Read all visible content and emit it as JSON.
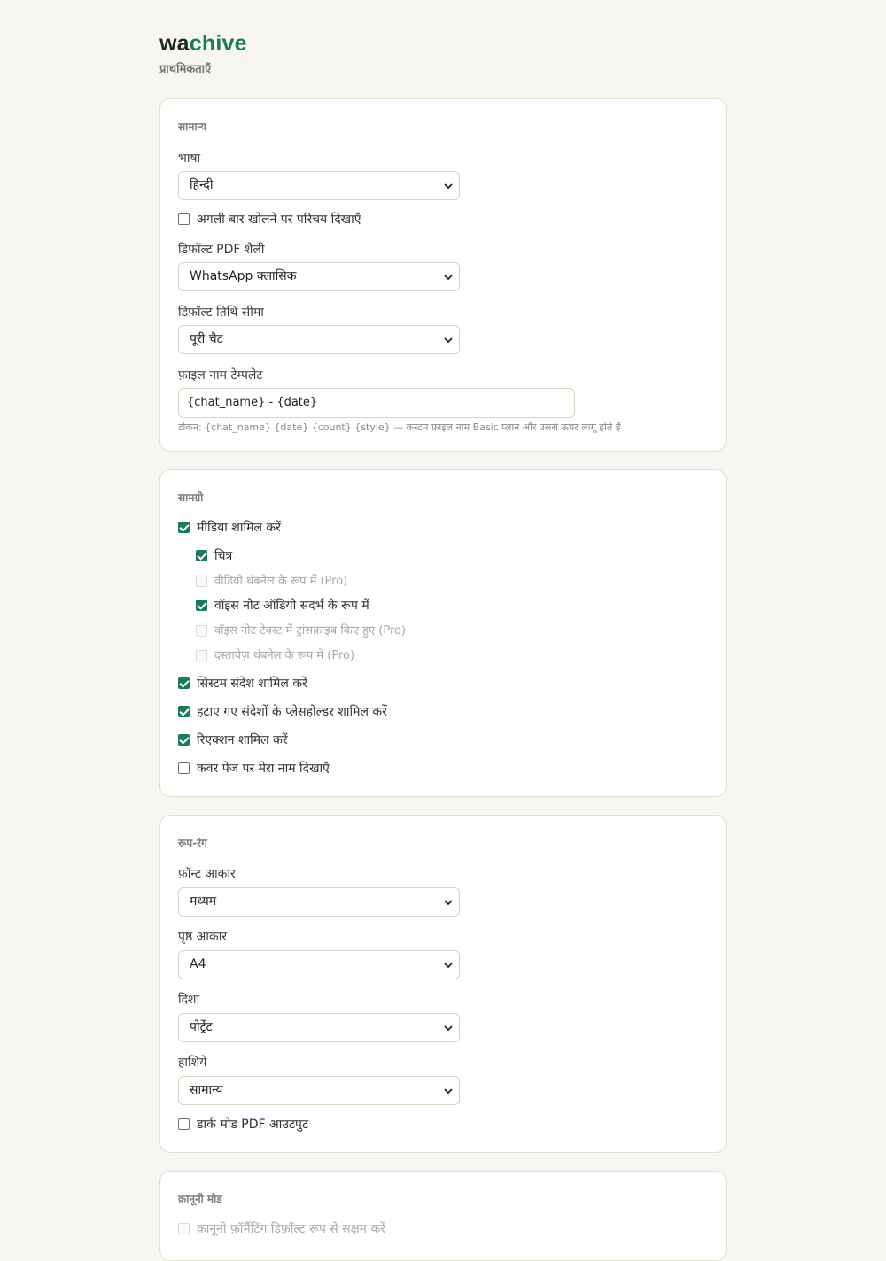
{
  "brand": {
    "prefix": "wa",
    "suffix": "chive",
    "accent": "#1a7a5e"
  },
  "page_title": "प्राथमिकताएँ",
  "general": {
    "title": "सामान्य",
    "language": {
      "label": "भाषा",
      "value": "हिन्दी"
    },
    "show_intro": {
      "label": "अगली बार खोलने पर परिचय दिखाएँ",
      "checked": false
    },
    "pdf_style": {
      "label": "डिफ़ॉल्ट PDF शैली",
      "value": "WhatsApp क्लासिक"
    },
    "date_range": {
      "label": "डिफ़ॉल्ट तिथि सीमा",
      "value": "पूरी चैट"
    },
    "filename": {
      "label": "फ़ाइल नाम टेम्पलेट",
      "value": "{chat_name} - {date}",
      "hint": "टोकन: {chat_name} {date} {count} {style} — कस्टम फ़ाइल नाम Basic प्लान और उससे ऊपर लागू होते हैं"
    }
  },
  "content": {
    "title": "सामग्री",
    "items": [
      {
        "label": "मीडिया शामिल करें",
        "checked": true,
        "disabled": false
      },
      {
        "label": "चित्र",
        "checked": true,
        "disabled": false
      },
      {
        "label": "वीडियो थंबनेल के रूप में (Pro)",
        "checked": false,
        "disabled": true
      },
      {
        "label": "वॉइस नोट ऑडियो संदर्भ के रूप में",
        "checked": true,
        "disabled": false
      },
      {
        "label": "वॉइस नोट टेक्स्ट में ट्रांसक्राइब किए हुए (Pro)",
        "checked": false,
        "disabled": true
      },
      {
        "label": "दस्तावेज़ थंबनेल के रूप में (Pro)",
        "checked": false,
        "disabled": true
      },
      {
        "label": "सिस्टम संदेश शामिल करें",
        "checked": true,
        "disabled": false
      },
      {
        "label": "हटाए गए संदेशों के प्लेसहोल्डर शामिल करें",
        "checked": true,
        "disabled": false
      },
      {
        "label": "रिएक्शन शामिल करें",
        "checked": true,
        "disabled": false
      },
      {
        "label": "कवर पेज पर मेरा नाम दिखाएँ",
        "checked": false,
        "disabled": false
      }
    ]
  },
  "appearance": {
    "title": "रूप-रंग",
    "font_size": {
      "label": "फ़ॉन्ट आकार",
      "value": "मध्यम"
    },
    "page_size": {
      "label": "पृष्ठ आकार",
      "value": "A4"
    },
    "orientation": {
      "label": "दिशा",
      "value": "पोर्ट्रेट"
    },
    "margins": {
      "label": "हाशिये",
      "value": "सामान्य"
    },
    "dark_mode": {
      "label": "डार्क मोड PDF आउटपुट",
      "checked": false
    }
  },
  "legal": {
    "title": "क़ानूनी मोड",
    "legal_formatting": {
      "label": "क़ानूनी फ़ॉर्मैटिंग डिफ़ॉल्ट रूप से सक्षम करें",
      "checked": false,
      "disabled": true
    }
  }
}
